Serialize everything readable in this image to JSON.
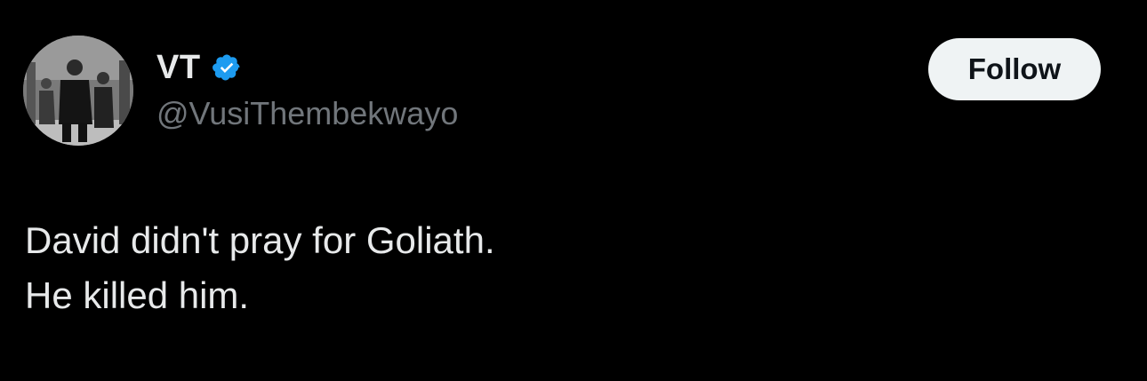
{
  "author": {
    "display_name": "VT",
    "handle": "@VusiThembekwayo",
    "verified": true,
    "avatar_icon": "avatar-photo-icon"
  },
  "actions": {
    "follow_label": "Follow"
  },
  "tweet": {
    "lines": [
      "David didn't pray for Goliath.",
      "He killed him."
    ]
  },
  "colors": {
    "background": "#000000",
    "primary_text": "#e7e9ea",
    "secondary_text": "#71767b",
    "verified_badge": "#1d9bf0",
    "follow_button_bg": "#eff3f4",
    "follow_button_text": "#0f1419"
  }
}
